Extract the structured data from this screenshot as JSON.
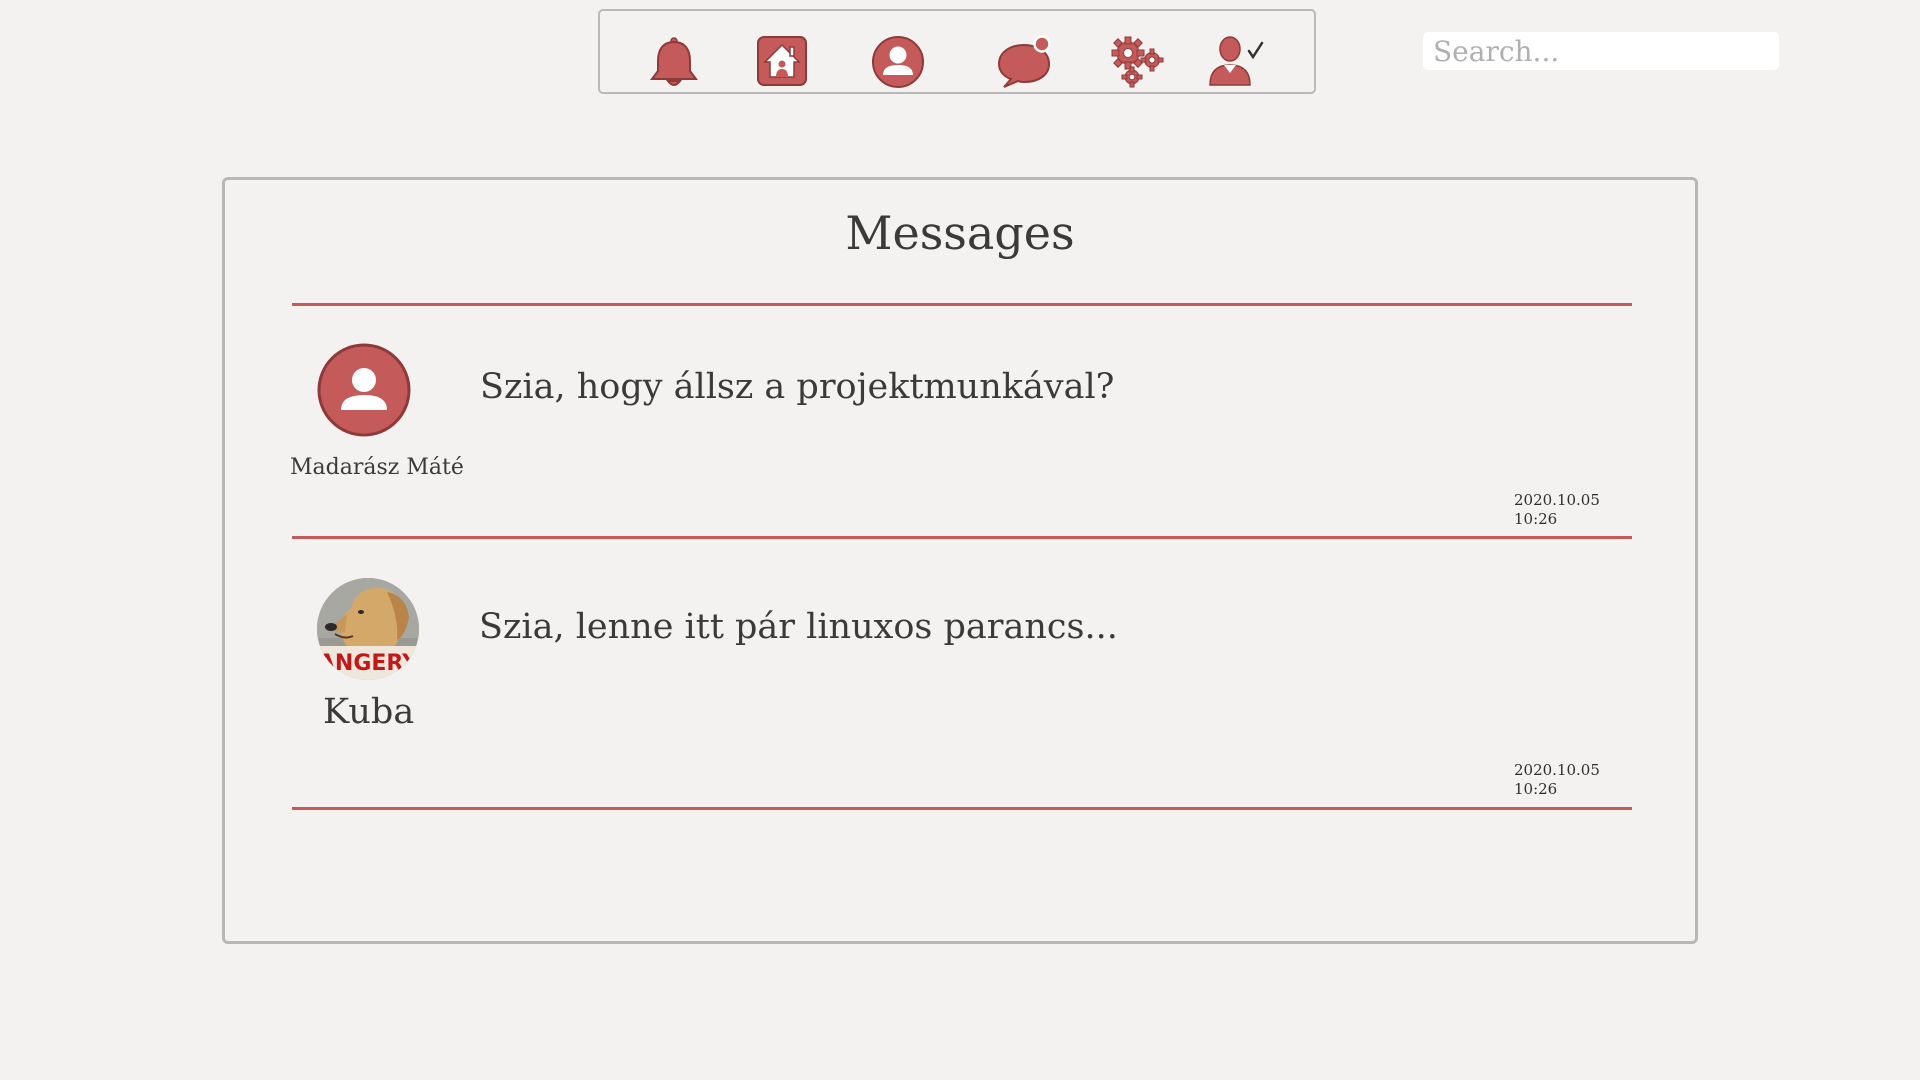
{
  "colors": {
    "accent": "#c45a5a",
    "background": "#f3f2f0",
    "border": "#b7b7b7",
    "text": "#3a3a3a"
  },
  "toolbar": {
    "icons": [
      "bell-icon",
      "home-icon",
      "profile-icon",
      "chat-notification-icon",
      "settings-gears-icon",
      "user-check-icon"
    ]
  },
  "search": {
    "placeholder": "Search..."
  },
  "messages_panel": {
    "title": "Messages",
    "messages": [
      {
        "sender": "Madarász Máté",
        "avatar": "default-user-avatar",
        "text": "Szia, hogy állsz a projektmunkával?",
        "time": "2020.10.05 10:26"
      },
      {
        "sender": "Kuba",
        "avatar": "dog-photo-avatar",
        "avatar_caption": "ANGERY",
        "text": "Szia, lenne itt pár linuxos parancs...",
        "time": "2020.10.05 10:26"
      }
    ]
  }
}
